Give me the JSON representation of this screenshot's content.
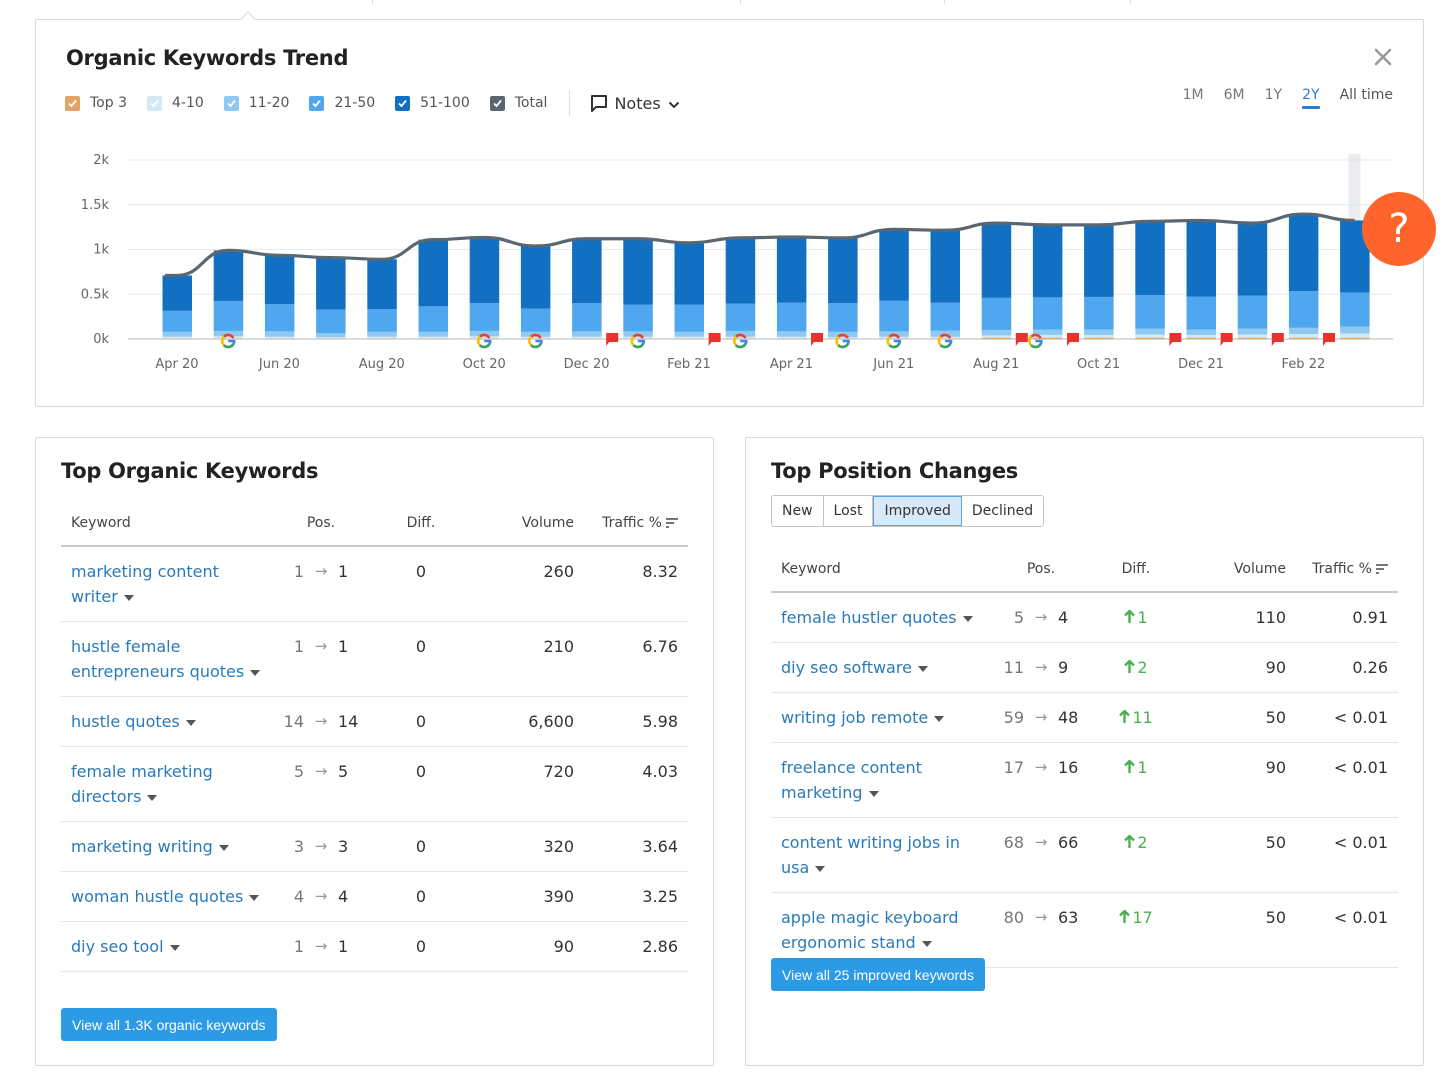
{
  "trend": {
    "title": "Organic Keywords Trend",
    "legend": [
      {
        "label": "Top 3",
        "color": "#e0a465",
        "checked": true
      },
      {
        "label": "4-10",
        "color": "#d4e9f7",
        "checked": true
      },
      {
        "label": "11-20",
        "color": "#8ec9f2",
        "checked": true
      },
      {
        "label": "21-50",
        "color": "#4fa8ef",
        "checked": true
      },
      {
        "label": "51-100",
        "color": "#1170c2",
        "checked": true
      },
      {
        "label": "Total",
        "color": "#5b6770",
        "checked": true
      }
    ],
    "notes_label": "Notes",
    "ranges": [
      "1M",
      "6M",
      "1Y",
      "2Y",
      "All time"
    ],
    "active_range": "2Y",
    "help_label": "?"
  },
  "chart_data": {
    "type": "bar",
    "stacked": true,
    "title": "Organic Keywords Trend",
    "ylim": [
      0,
      2000
    ],
    "yticks": [
      "0k",
      "0.5k",
      "1k",
      "1.5k",
      "2k"
    ],
    "ytick_values": [
      0,
      500,
      1000,
      1500,
      2000
    ],
    "xtick_labels": [
      "Apr 20",
      "Jun 20",
      "Aug 20",
      "Oct 20",
      "Dec 20",
      "Feb 21",
      "Apr 21",
      "Jun 21",
      "Aug 21",
      "Oct 21",
      "Dec 21",
      "Feb 22"
    ],
    "categories": [
      "Apr 20",
      "May 20",
      "Jun 20",
      "Jul 20",
      "Aug 20",
      "Sep 20",
      "Oct 20",
      "Nov 20",
      "Dec 20",
      "Jan 21",
      "Feb 21",
      "Mar 21",
      "Apr 21",
      "May 21",
      "Jun 21",
      "Jul 21",
      "Aug 21",
      "Sep 21",
      "Oct 21",
      "Nov 21",
      "Dec 21",
      "Jan 22",
      "Feb 22",
      "Mar 22"
    ],
    "series": [
      {
        "name": "Top 3",
        "color": "#e0a465",
        "values": [
          5,
          5,
          5,
          5,
          5,
          5,
          5,
          5,
          5,
          5,
          5,
          5,
          5,
          5,
          5,
          5,
          15,
          15,
          15,
          15,
          15,
          15,
          15,
          15
        ]
      },
      {
        "name": "4-10",
        "color": "#d4e9f7",
        "values": [
          20,
          25,
          20,
          15,
          20,
          20,
          25,
          20,
          20,
          20,
          20,
          20,
          20,
          15,
          20,
          20,
          25,
          30,
          30,
          35,
          30,
          35,
          40,
          45
        ]
      },
      {
        "name": "11-20",
        "color": "#8ec9f2",
        "values": [
          55,
          60,
          60,
          45,
          55,
          55,
          60,
          55,
          60,
          60,
          55,
          65,
          60,
          60,
          60,
          70,
          60,
          60,
          60,
          65,
          60,
          65,
          70,
          80
        ]
      },
      {
        "name": "21-50",
        "color": "#4fa8ef",
        "values": [
          235,
          335,
          305,
          265,
          255,
          285,
          310,
          260,
          315,
          300,
          305,
          305,
          320,
          320,
          345,
          310,
          360,
          360,
          365,
          375,
          370,
          370,
          410,
          380
        ]
      },
      {
        "name": "51-100",
        "color": "#1170c2",
        "values": [
          395,
          565,
          545,
          580,
          555,
          745,
          735,
          700,
          720,
          735,
          690,
          725,
          735,
          735,
          795,
          810,
          835,
          810,
          805,
          825,
          850,
          810,
          860,
          805
        ]
      },
      {
        "name": "Total",
        "color": "#5b6770",
        "type": "line",
        "values": [
          710,
          990,
          935,
          910,
          890,
          1110,
          1135,
          1040,
          1120,
          1120,
          1075,
          1130,
          1140,
          1130,
          1225,
          1215,
          1295,
          1275,
          1275,
          1315,
          1325,
          1295,
          1395,
          1325
        ]
      }
    ],
    "markers": {
      "google": [
        "May 20",
        "Oct 20",
        "Nov 20",
        "Jan 21",
        "Mar 21",
        "May 21",
        "Jun 21",
        "Jul 21",
        "Sep 21"
      ],
      "note_flags": [
        "Dec 20",
        "Feb 21",
        "Apr 21",
        "Aug 21",
        "Sep 21",
        "Nov 21",
        "Dec 21",
        "Jan 22",
        "Feb 22"
      ]
    },
    "legend": "top-left",
    "grid": true
  },
  "top_organic": {
    "title": "Top Organic Keywords",
    "columns": [
      "Keyword",
      "Pos.",
      "Diff.",
      "Volume",
      "Traffic %"
    ],
    "rows": [
      {
        "keyword": "marketing content writer",
        "pos_from": "1",
        "pos_to": "1",
        "diff": "0",
        "volume": "260",
        "traffic": "8.32"
      },
      {
        "keyword": "hustle female entrepreneurs quotes",
        "pos_from": "1",
        "pos_to": "1",
        "diff": "0",
        "volume": "210",
        "traffic": "6.76"
      },
      {
        "keyword": "hustle quotes",
        "pos_from": "14",
        "pos_to": "14",
        "diff": "0",
        "volume": "6,600",
        "traffic": "5.98"
      },
      {
        "keyword": "female marketing directors",
        "pos_from": "5",
        "pos_to": "5",
        "diff": "0",
        "volume": "720",
        "traffic": "4.03"
      },
      {
        "keyword": "marketing writing",
        "pos_from": "3",
        "pos_to": "3",
        "diff": "0",
        "volume": "320",
        "traffic": "3.64"
      },
      {
        "keyword": "woman hustle quotes",
        "pos_from": "4",
        "pos_to": "4",
        "diff": "0",
        "volume": "390",
        "traffic": "3.25"
      },
      {
        "keyword": "diy seo tool",
        "pos_from": "1",
        "pos_to": "1",
        "diff": "0",
        "volume": "90",
        "traffic": "2.86"
      }
    ],
    "button": "View all 1.3K organic keywords"
  },
  "top_changes": {
    "title": "Top Position Changes",
    "tabs": [
      "New",
      "Lost",
      "Improved",
      "Declined"
    ],
    "active_tab": "Improved",
    "columns": [
      "Keyword",
      "Pos.",
      "Diff.",
      "Volume",
      "Traffic %"
    ],
    "rows": [
      {
        "keyword": "female hustler quotes",
        "pos_from": "5",
        "pos_to": "4",
        "diff": "1",
        "volume": "110",
        "traffic": "0.91"
      },
      {
        "keyword": "diy seo software",
        "pos_from": "11",
        "pos_to": "9",
        "diff": "2",
        "volume": "90",
        "traffic": "0.26"
      },
      {
        "keyword": "writing job remote",
        "pos_from": "59",
        "pos_to": "48",
        "diff": "11",
        "volume": "50",
        "traffic": "< 0.01"
      },
      {
        "keyword": "freelance content marketing",
        "pos_from": "17",
        "pos_to": "16",
        "diff": "1",
        "volume": "90",
        "traffic": "< 0.01"
      },
      {
        "keyword": "content writing jobs in usa",
        "pos_from": "68",
        "pos_to": "66",
        "diff": "2",
        "volume": "50",
        "traffic": "< 0.01"
      },
      {
        "keyword": "apple magic keyboard ergonomic stand",
        "pos_from": "80",
        "pos_to": "63",
        "diff": "17",
        "volume": "50",
        "traffic": "< 0.01"
      }
    ],
    "button": "View all 25 improved keywords"
  },
  "arrow_glyph": "→",
  "up_glyph": "🡑"
}
